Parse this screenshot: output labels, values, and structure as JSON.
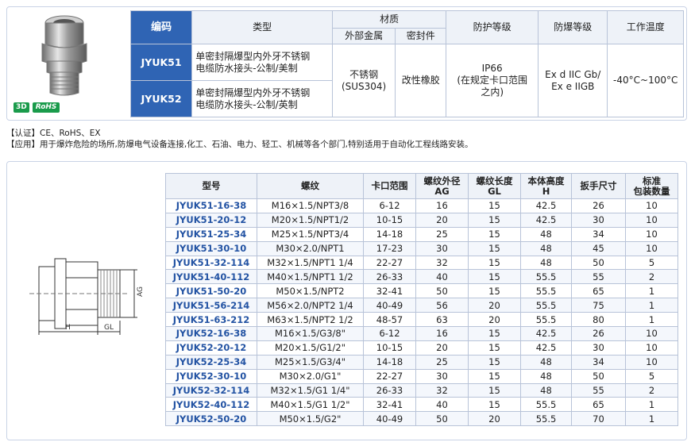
{
  "badges": {
    "three_d": "3D",
    "rohs": "RoHS"
  },
  "spec_table": {
    "headers": {
      "code": "编码",
      "type": "类型",
      "material": "材质",
      "material_metal": "外部金属",
      "material_seal": "密封件",
      "protection": "防护等级",
      "explosion": "防爆等级",
      "temperature": "工作温度"
    },
    "rows": [
      {
        "code": "JYUK51",
        "type_line1": "单密封隔爆型内外牙不锈钢",
        "type_line2": "电缆防水接头-公制/美制"
      },
      {
        "code": "JYUK52",
        "type_line1": "单密封隔爆型内外牙不锈钢",
        "type_line2": "电缆防水接头-公制/英制"
      }
    ],
    "metal_line1": "不锈钢",
    "metal_line2": "(SUS304)",
    "seal": "改性橡胶",
    "protection_line1": "IP66",
    "protection_line2": "(在规定卡口范围",
    "protection_line3": "之内)",
    "explosion_line1": "Ex d IIC Gb/",
    "explosion_line2": "Ex e IIGB",
    "temperature": "-40°C~100°C"
  },
  "notes": {
    "certification": "【认证】CE、RoHS、EX",
    "application": "【应用】用于爆炸危险的场所,防爆电气设备连接,化工、石油、电力、轻工、机械等各个部门,特别适用于自动化工程线路安装。"
  },
  "drawing_labels": {
    "ag": "AG",
    "h": "H",
    "gl": "GL"
  },
  "dim_table": {
    "headers": {
      "model": "型号",
      "thread": "螺纹",
      "clamp_range": "卡口范围",
      "ag_line1": "螺纹外径",
      "ag_line2": "AG",
      "gl_line1": "螺纹长度",
      "gl_line2": "GL",
      "h_line1": "本体高度",
      "h_line2": "H",
      "wrench": "扳手尺寸",
      "pack_line1": "标准",
      "pack_line2": "包装数量"
    },
    "rows": [
      [
        "JYUK51-16-38",
        "M16×1.5/NPT3/8",
        "6-12",
        "16",
        "15",
        "42.5",
        "26",
        "10"
      ],
      [
        "JYUK51-20-12",
        "M20×1.5/NPT1/2",
        "10-15",
        "20",
        "15",
        "42.5",
        "30",
        "10"
      ],
      [
        "JYUK51-25-34",
        "M25×1.5/NPT3/4",
        "14-18",
        "25",
        "15",
        "48",
        "34",
        "10"
      ],
      [
        "JYUK51-30-10",
        "M30×2.0/NPT1",
        "17-23",
        "30",
        "15",
        "48",
        "45",
        "10"
      ],
      [
        "JYUK51-32-114",
        "M32×1.5/NPT1 1/4",
        "22-27",
        "32",
        "15",
        "48",
        "50",
        "5"
      ],
      [
        "JYUK51-40-112",
        "M40×1.5/NPT1 1/2",
        "26-33",
        "40",
        "15",
        "55.5",
        "55",
        "2"
      ],
      [
        "JYUK51-50-20",
        "M50×1.5/NPT2",
        "32-41",
        "50",
        "15",
        "55.5",
        "65",
        "1"
      ],
      [
        "JYUK51-56-214",
        "M56×2.0/NPT2 1/4",
        "40-49",
        "56",
        "20",
        "55.5",
        "75",
        "1"
      ],
      [
        "JYUK51-63-212",
        "M63×1.5/NPT2 1/2",
        "48-57",
        "63",
        "20",
        "55.5",
        "80",
        "1"
      ],
      [
        "JYUK52-16-38",
        "M16×1.5/G3/8\"",
        "6-12",
        "16",
        "15",
        "42.5",
        "26",
        "10"
      ],
      [
        "JYUK52-20-12",
        "M20×1.5/G1/2\"",
        "10-15",
        "20",
        "15",
        "42.5",
        "30",
        "10"
      ],
      [
        "JYUK52-25-34",
        "M25×1.5/G3/4\"",
        "14-18",
        "25",
        "15",
        "48",
        "34",
        "10"
      ],
      [
        "JYUK52-30-10",
        "M30×2.0/G1\"",
        "22-27",
        "30",
        "15",
        "48",
        "50",
        "5"
      ],
      [
        "JYUK52-32-114",
        "M32×1.5/G1 1/4\"",
        "26-33",
        "32",
        "15",
        "48",
        "55",
        "2"
      ],
      [
        "JYUK52-40-112",
        "M40×1.5/G1 1/2\"",
        "32-41",
        "40",
        "15",
        "55.5",
        "65",
        "1"
      ],
      [
        "JYUK52-50-20",
        "M50×1.5/G2\"",
        "40-49",
        "50",
        "20",
        "55.5",
        "70",
        "1"
      ]
    ]
  },
  "colors": {
    "header_blue": "#2f64b4",
    "model_text_blue": "#2353a3",
    "badge_green": "#1a9b4b"
  }
}
